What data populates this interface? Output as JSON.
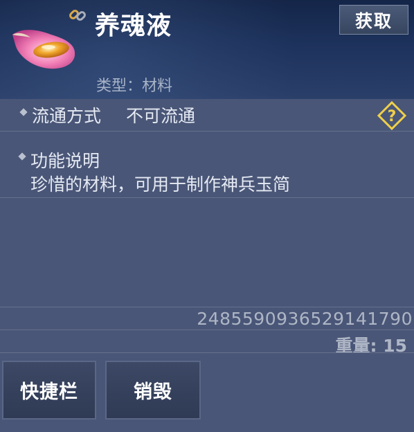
{
  "item": {
    "name": "养魂液",
    "type_text": "类型：材料",
    "obtain_label": "获取"
  },
  "circulation": {
    "label": "流通方式",
    "value": "不可流通"
  },
  "function": {
    "title": "功能说明",
    "description": "珍惜的材料，可用于制作神兵玉简"
  },
  "footer": {
    "item_id": "2485590936529141790",
    "weight_text": "重量: 15"
  },
  "actions": {
    "shortcut_label": "快捷栏",
    "destroy_label": "销毁"
  },
  "icons": {
    "item": "pink-petal-bowl-icon",
    "bound": "chain-link-icon",
    "help": "question-diamond-icon"
  },
  "colors": {
    "header_bg": "#1d325c",
    "panel_bg": "#4a5677",
    "button_bg": "#34405c",
    "help_icon": "#f0d04a"
  }
}
